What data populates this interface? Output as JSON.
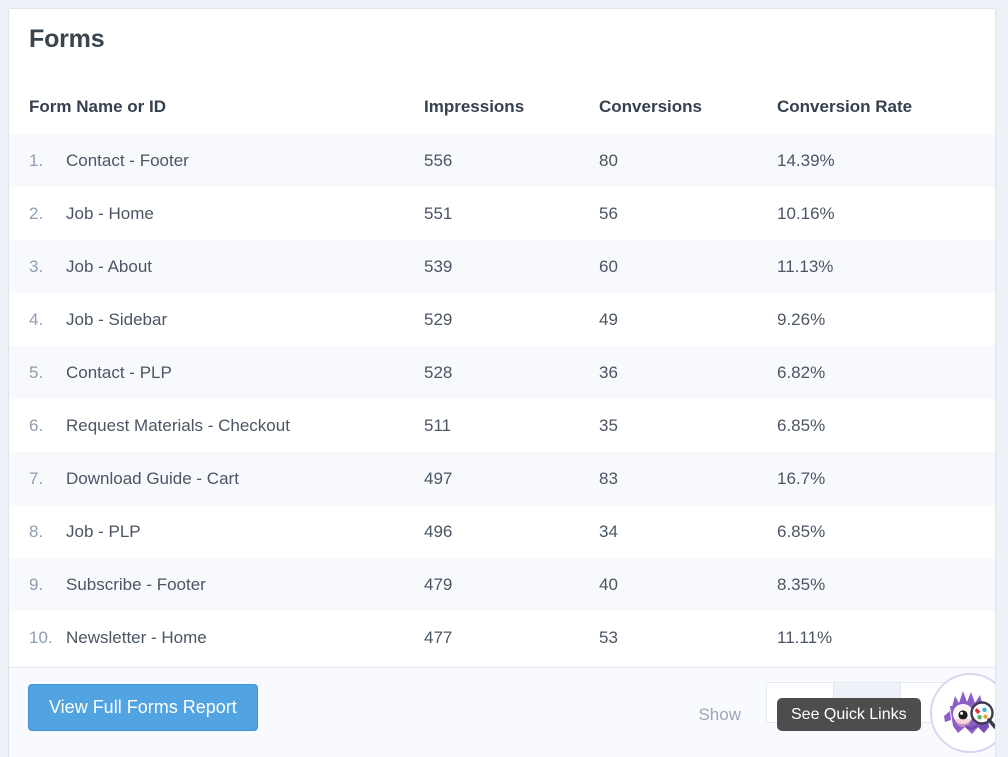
{
  "card": {
    "title": "Forms"
  },
  "table": {
    "columns": [
      {
        "key": "name",
        "label": "Form Name or ID"
      },
      {
        "key": "impressions",
        "label": "Impressions"
      },
      {
        "key": "conversions",
        "label": "Conversions"
      },
      {
        "key": "rate",
        "label": "Conversion Rate"
      }
    ],
    "rows": [
      {
        "index": "1.",
        "name": "Contact - Footer",
        "impressions": "556",
        "conversions": "80",
        "rate": "14.39%"
      },
      {
        "index": "2.",
        "name": "Job - Home",
        "impressions": "551",
        "conversions": "56",
        "rate": "10.16%"
      },
      {
        "index": "3.",
        "name": "Job - About",
        "impressions": "539",
        "conversions": "60",
        "rate": "11.13%"
      },
      {
        "index": "4.",
        "name": "Job - Sidebar",
        "impressions": "529",
        "conversions": "49",
        "rate": "9.26%"
      },
      {
        "index": "5.",
        "name": "Contact - PLP",
        "impressions": "528",
        "conversions": "36",
        "rate": "6.82%"
      },
      {
        "index": "6.",
        "name": "Request Materials - Checkout",
        "impressions": "511",
        "conversions": "35",
        "rate": "6.85%"
      },
      {
        "index": "7.",
        "name": "Download Guide - Cart",
        "impressions": "497",
        "conversions": "83",
        "rate": "16.7%"
      },
      {
        "index": "8.",
        "name": "Job - PLP",
        "impressions": "496",
        "conversions": "34",
        "rate": "6.85%"
      },
      {
        "index": "9.",
        "name": "Subscribe - Footer",
        "impressions": "479",
        "conversions": "40",
        "rate": "8.35%"
      },
      {
        "index": "10.",
        "name": "Newsletter - Home",
        "impressions": "477",
        "conversions": "53",
        "rate": "11.11%"
      }
    ]
  },
  "footer": {
    "report_button_label": "View Full Forms Report",
    "show_label": "Show",
    "segments": [
      {
        "name": "segment-1",
        "shaded": false
      },
      {
        "name": "segment-2",
        "shaded": true
      },
      {
        "name": "segment-3",
        "shaded": false
      }
    ]
  },
  "tooltip": {
    "text": "See Quick Links"
  },
  "mascot": {
    "icon": "monster-magnifier-icon",
    "body_color": "#8b5fc4",
    "body_dark": "#7248ad",
    "accent_color": "#ffffff"
  },
  "colors": {
    "accent_button": "#52a3e2",
    "page_background": "#eef2f8",
    "card_background": "#ffffff",
    "row_stripe": "#f7f9fd",
    "footer_background": "#f9fafd",
    "tooltip_background": "#4d4d4d",
    "title_text": "#39444f",
    "muted_text": "#9aa6b8"
  }
}
